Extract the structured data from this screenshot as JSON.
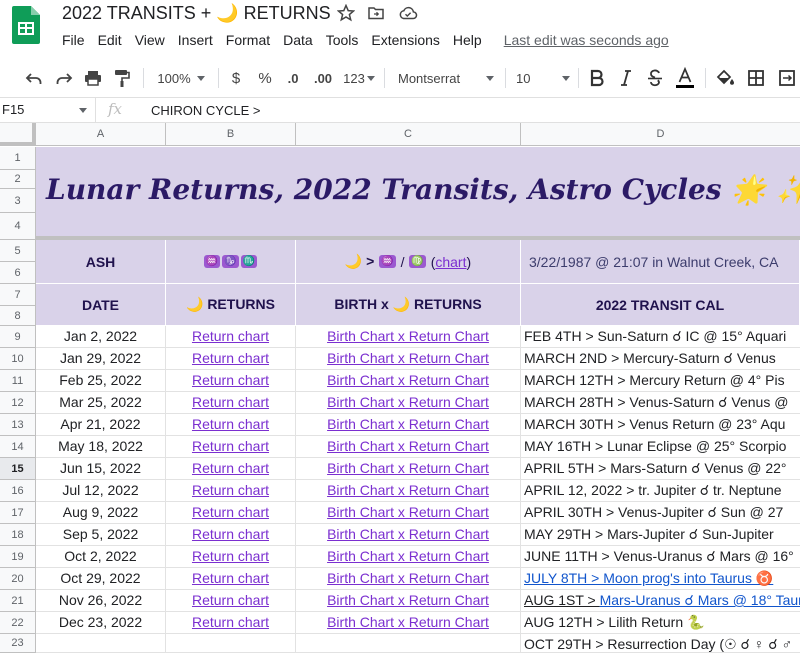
{
  "app": {
    "doc_title": "2022 TRANSITS + 🌙 RETURNS",
    "menu": [
      "File",
      "Edit",
      "View",
      "Insert",
      "Format",
      "Data",
      "Tools",
      "Extensions",
      "Help"
    ],
    "last_edit": "Last edit was seconds ago"
  },
  "toolbar": {
    "zoom": "100%",
    "currency": "$",
    "percent": "%",
    "dec_less": ".0",
    "dec_more": ".00",
    "format_more": "123",
    "font": "Montserrat",
    "font_size": "10"
  },
  "formula_bar": {
    "cell_ref": "F15",
    "fx": "fx",
    "value": "CHIRON CYCLE >"
  },
  "columns": [
    "A",
    "B",
    "C",
    "D"
  ],
  "rows": [
    "1",
    "2",
    "3",
    "4",
    "5",
    "6",
    "7",
    "8",
    "9",
    "10",
    "11",
    "12",
    "13",
    "14",
    "15",
    "16",
    "17",
    "18",
    "19",
    "20",
    "21",
    "22",
    "23"
  ],
  "selected_row": "15",
  "banner": {
    "title": "Lunar Returns, 2022 Transits, Astro Cycles 🌟 ✨"
  },
  "info_row": {
    "name": "ASH",
    "signs": [
      "♒",
      "♑",
      "♏"
    ],
    "chart_prefix": "🌙 >",
    "chart_signs": [
      "♒",
      "♍"
    ],
    "chart_sep": "/",
    "chart_link": "chart",
    "birth": "3/22/1987 @ 21:07 in Walnut Creek, CA"
  },
  "header_row": {
    "date": "DATE",
    "returns": "🌙 RETURNS",
    "birth_x": "BIRTH x 🌙 RETURNS",
    "transit_cal": "2022 TRANSIT CAL"
  },
  "table": [
    {
      "date": "Jan 2, 2022",
      "ret": "Return chart",
      "birth": "Birth Chart x Return Chart",
      "transit": "FEB 4TH > Sun-Saturn ☌ IC @ 15° Aquari"
    },
    {
      "date": "Jan 29, 2022",
      "ret": "Return chart",
      "birth": "Birth Chart x Return Chart",
      "transit": "MARCH 2ND > Mercury-Saturn ☌ Venus"
    },
    {
      "date": "Feb 25, 2022",
      "ret": "Return chart",
      "birth": "Birth Chart x Return Chart",
      "transit": "MARCH 12TH > Mercury Return @ 4° Pis"
    },
    {
      "date": "Mar 25, 2022",
      "ret": "Return chart",
      "birth": "Birth Chart x Return Chart",
      "transit": "MARCH 28TH > Venus-Saturn ☌ Venus @"
    },
    {
      "date": "Apr 21, 2022",
      "ret": "Return chart",
      "birth": "Birth Chart x Return Chart",
      "transit": "MARCH 30TH > Venus Return @ 23° Aqu"
    },
    {
      "date": "May 18, 2022",
      "ret": "Return chart",
      "birth": "Birth Chart x Return Chart",
      "transit": "MAY 16TH > Lunar Eclipse @ 25° Scorpio"
    },
    {
      "date": "Jun 15, 2022",
      "ret": "Return chart",
      "birth": "Birth Chart x Return Chart",
      "transit": "APRIL 5TH > Mars-Saturn ☌ Venus @ 22°"
    },
    {
      "date": "Jul 12, 2022",
      "ret": "Return chart",
      "birth": "Birth Chart x Return Chart",
      "transit": "APRIL 12, 2022 > tr. Jupiter ☌ tr. Neptune"
    },
    {
      "date": "Aug 9, 2022",
      "ret": "Return chart",
      "birth": "Birth Chart x Return Chart",
      "transit": "APRIL 30TH > Venus-Jupiter ☌ Sun @ 27"
    },
    {
      "date": "Sep 5, 2022",
      "ret": "Return chart",
      "birth": "Birth Chart x Return Chart",
      "transit": "MAY 29TH > Mars-Jupiter ☌ Sun-Jupiter"
    },
    {
      "date": "Oct 2, 2022",
      "ret": "Return chart",
      "birth": "Birth Chart x Return Chart",
      "transit": "JUNE 11TH > Venus-Uranus ☌ Mars @ 16°"
    },
    {
      "date": "Oct 29, 2022",
      "ret": "Return chart",
      "birth": "Birth Chart x Return Chart",
      "transit": "JULY 8TH > Moon prog's into Taurus ♉",
      "transit_style": "blue"
    },
    {
      "date": "Nov 26, 2022",
      "ret": "Return chart",
      "birth": "Birth Chart x Return Chart",
      "transit_prefix": "AUG 1ST > ",
      "transit_link": "Mars-Uranus ☌ Mars @ 18° Taur",
      "transit_style": "mixed"
    },
    {
      "date": "Dec 23, 2022",
      "ret": "Return chart",
      "birth": "Birth Chart x Return Chart",
      "transit": "AUG 12TH > Lilith Return 🐍"
    },
    {
      "date": "",
      "ret": "",
      "birth": "",
      "transit": "OCT 29TH > Resurrection Day (☉ ☌ ♀ ☌ ♂"
    }
  ]
}
